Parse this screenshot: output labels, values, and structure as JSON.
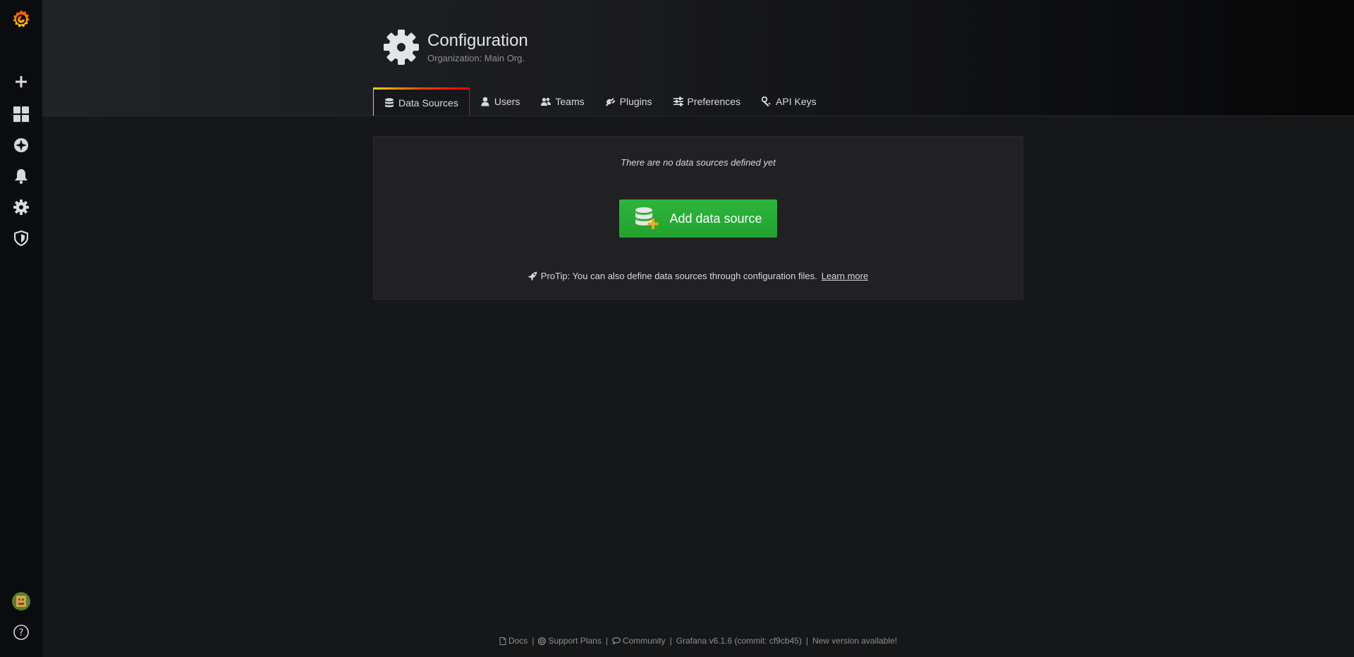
{
  "sidemenu": {
    "items": [
      {
        "name": "grafana-logo-icon"
      },
      {
        "name": "create-icon"
      },
      {
        "name": "dashboards-icon"
      },
      {
        "name": "explore-icon"
      },
      {
        "name": "alerting-icon"
      },
      {
        "name": "configuration-icon"
      },
      {
        "name": "server-admin-icon"
      },
      {
        "name": "user-avatar"
      },
      {
        "name": "help-icon"
      }
    ]
  },
  "header": {
    "title": "Configuration",
    "subtitle": "Organization: Main Org.",
    "icon": "gear-icon"
  },
  "tabs": [
    {
      "label": "Data Sources",
      "icon": "database-icon",
      "active": true
    },
    {
      "label": "Users",
      "icon": "user-icon",
      "active": false
    },
    {
      "label": "Teams",
      "icon": "users-icon",
      "active": false
    },
    {
      "label": "Plugins",
      "icon": "plug-icon",
      "active": false
    },
    {
      "label": "Preferences",
      "icon": "sliders-icon",
      "active": false
    },
    {
      "label": "API Keys",
      "icon": "key-icon",
      "active": false
    }
  ],
  "empty_state": {
    "message": "There are no data sources defined yet",
    "button_label": "Add data source",
    "protip": "ProTip: You can also define data sources through configuration files.",
    "learn_more": "Learn more"
  },
  "footer": {
    "docs": "Docs",
    "support": "Support Plans",
    "community": "Community",
    "version": "Grafana v6.1.6 (commit: cf9cb45)",
    "new_version": "New version available!"
  },
  "colors": {
    "accent_green": "#2eb53d",
    "tab_gradient": [
      "#ffd500",
      "#ff4400",
      "#eb0000"
    ],
    "sidebar_bg": "#0b0c0e",
    "page_bg": "#161719"
  }
}
